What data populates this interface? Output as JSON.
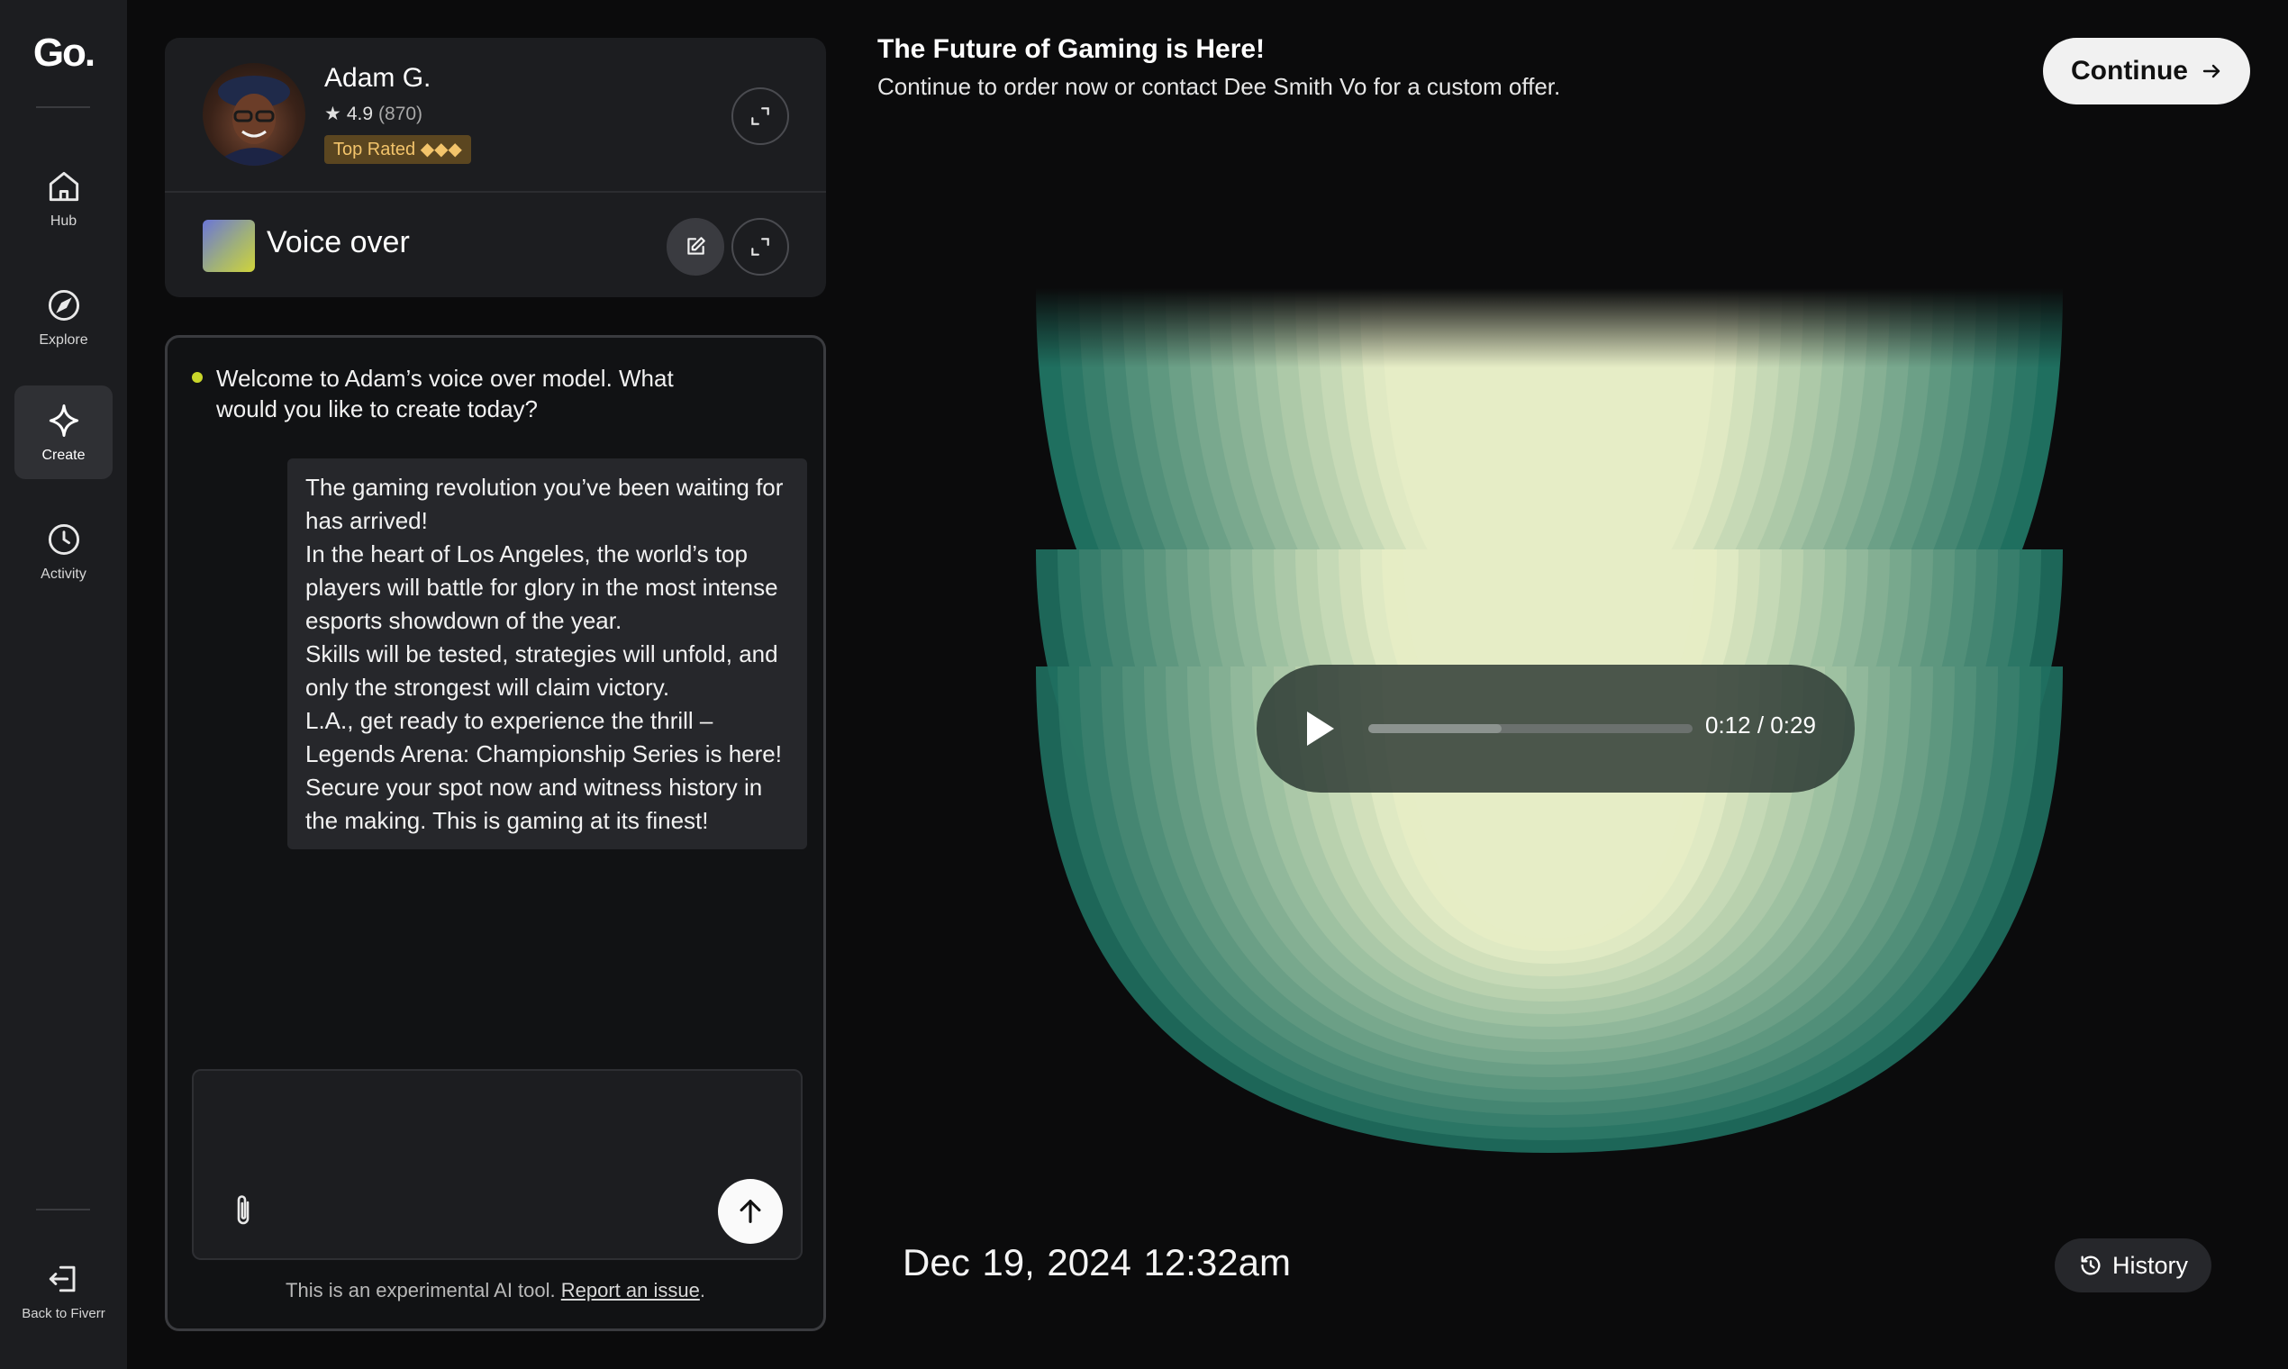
{
  "nav": {
    "logo": "Go.",
    "items": [
      {
        "label": "Hub",
        "icon": "home-icon"
      },
      {
        "label": "Explore",
        "icon": "compass-icon"
      },
      {
        "label": "Create",
        "icon": "sparkle-icon",
        "active": true
      },
      {
        "label": "Activity",
        "icon": "clock-icon"
      }
    ],
    "back_label": "Back to Fiverr"
  },
  "seller": {
    "name": "Adam G.",
    "rating": "4.9",
    "reviews": "(870)",
    "badge": "Top Rated ◆◆◆"
  },
  "model": {
    "title": "Voice over"
  },
  "chat": {
    "bot_message": "Welcome to Adam’s voice over model. What would you like to create today?",
    "user_message": "The gaming revolution you’ve been waiting for has arrived!\nIn the heart of Los Angeles, the world’s top players will battle for glory in the most intense esports showdown of the year.\n Skills will be tested, strategies will unfold, and only the strongest will claim victory.\n L.A., get ready to experience the thrill – Legends Arena: Championship Series is here!\n Secure your spot now and witness history in the making. This is gaming at its finest!",
    "input_value": "",
    "disclaimer": "This is an experimental AI tool.",
    "report_link": "Report an issue",
    "disclaimer_end": "."
  },
  "header": {
    "title": "The Future of Gaming is Here!",
    "subtitle": "Continue to order now or contact Dee Smith Vo for a custom offer.",
    "continue_label": "Continue"
  },
  "player": {
    "current": "0:12",
    "total": "0:29",
    "progress_fraction": 0.41
  },
  "footer": {
    "date": "Dec 19, 2024",
    "time": "12:32am",
    "history_label": "History"
  },
  "colors": {
    "accent_dot": "#c9d62a",
    "badge_text": "#f3c46b",
    "visual_dark": "#1f6f5f",
    "visual_light": "#e6edc6"
  }
}
